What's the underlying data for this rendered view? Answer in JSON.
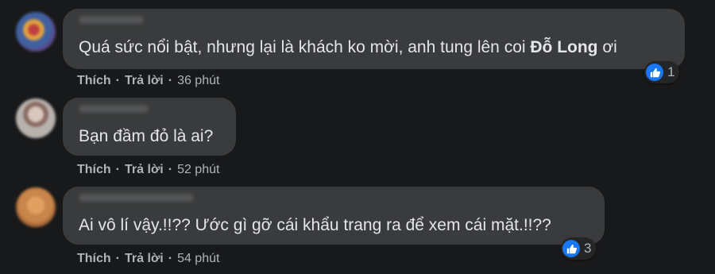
{
  "comments": [
    {
      "text_before": "Quá sức nổi bật, nhưng lại là khách ko mời, anh tung lên coi ",
      "mention": "Đỗ Long",
      "text_after": " ơi",
      "actions": {
        "like": "Thích",
        "reply": "Trả lời",
        "time": "36 phút"
      },
      "reactions": {
        "icon": "like-icon",
        "count": "1"
      },
      "avatar_color": "#5a4a8a"
    },
    {
      "text_before": "Bạn đầm đỏ là ai?",
      "mention": "",
      "text_after": "",
      "actions": {
        "like": "Thích",
        "reply": "Trả lời",
        "time": "52 phút"
      },
      "avatar_color": "#b8b2ae"
    },
    {
      "text_before": "Ai vô lí vậy.!!?? Ước gì gỡ cái khẩu trang ra để xem cái mặt.!!??",
      "mention": "",
      "text_after": "",
      "actions": {
        "like": "Thích",
        "reply": "Trả lời",
        "time": "54 phút"
      },
      "reactions": {
        "icon": "like-icon",
        "count": "3"
      },
      "avatar_color": "#c9854a"
    }
  ],
  "separator": "·",
  "colors": {
    "background": "#18191a",
    "bubble": "#3a3b3c",
    "text": "#e4e6eb",
    "secondary_text": "#b0b3b8",
    "like_blue": "#1877f2"
  }
}
